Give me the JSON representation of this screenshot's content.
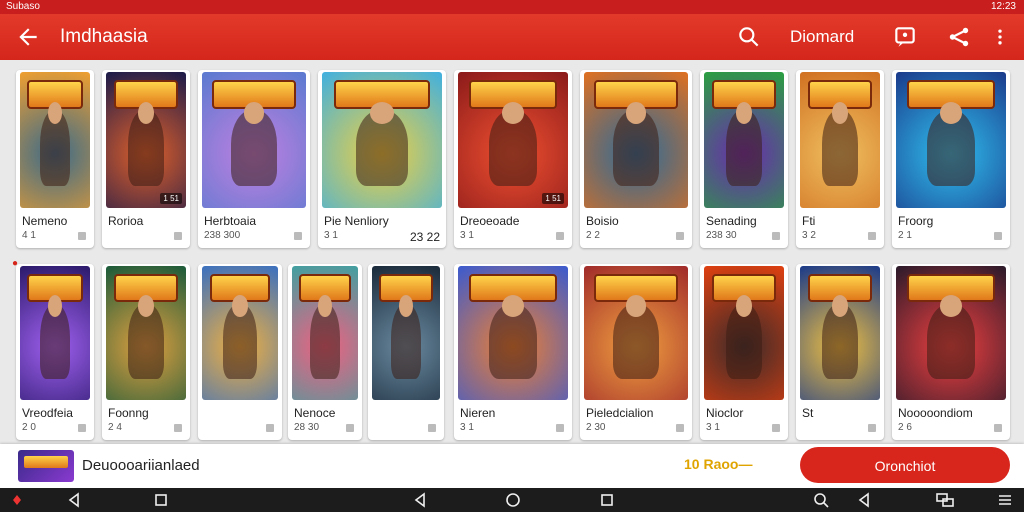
{
  "status": {
    "left": "Subaso",
    "right": "12:23"
  },
  "appbar": {
    "title": "Imdhaasia",
    "domain_label": "Diomard"
  },
  "colors": {
    "brand": "#d5261c",
    "statusbar": "#c81e1e",
    "cta": "#d8261c",
    "promo": "#e0a400"
  },
  "icons": {
    "back": "back-arrow-icon",
    "search": "search-icon",
    "chat": "chat-icon",
    "share": "share-icon",
    "more": "more-vert-icon"
  },
  "games": [
    {
      "name": "Nemeno",
      "sub": "4 1",
      "badge": ""
    },
    {
      "name": "Rorioa",
      "sub": "",
      "badge": "1 51"
    },
    {
      "name": "Herbtoaia",
      "sub": "238 300",
      "badge": ""
    },
    {
      "name": "Pie Nenliory",
      "sub": "3 1",
      "sub_right": "23 22",
      "badge": ""
    },
    {
      "name": "Dreoeoade",
      "sub": "3 1",
      "badge": "1 51"
    },
    {
      "name": "Boisio",
      "sub": "2 2",
      "badge": ""
    },
    {
      "name": "Senading",
      "sub": "238 30",
      "badge": ""
    },
    {
      "name": "Fti",
      "sub": "3 2",
      "badge": ""
    },
    {
      "name": "Froorg",
      "sub": "2 1",
      "badge": ""
    },
    {
      "name": "Vreodfeia",
      "sub": "2 0",
      "badge": ""
    },
    {
      "name": "Foonng",
      "sub": "2 4",
      "badge": ""
    },
    {
      "name": "",
      "sub": "",
      "badge": ""
    },
    {
      "name": "Nenoce",
      "sub": "28 30",
      "badge": ""
    },
    {
      "name": "",
      "sub": "",
      "badge": ""
    },
    {
      "name": "Nieren",
      "sub": "3 1",
      "badge": ""
    },
    {
      "name": "Pieledcialion",
      "sub": "2 30",
      "badge": ""
    },
    {
      "name": "Nioclor",
      "sub": "3 1",
      "badge": ""
    },
    {
      "name": "St",
      "sub": "",
      "badge": ""
    },
    {
      "name": "Nooooondiom",
      "sub": "2 6",
      "badge": ""
    }
  ],
  "bottom": {
    "title": "Deuoooariianlaed",
    "promo": "10 Raoo—",
    "cta_label": "Oronchiot"
  }
}
